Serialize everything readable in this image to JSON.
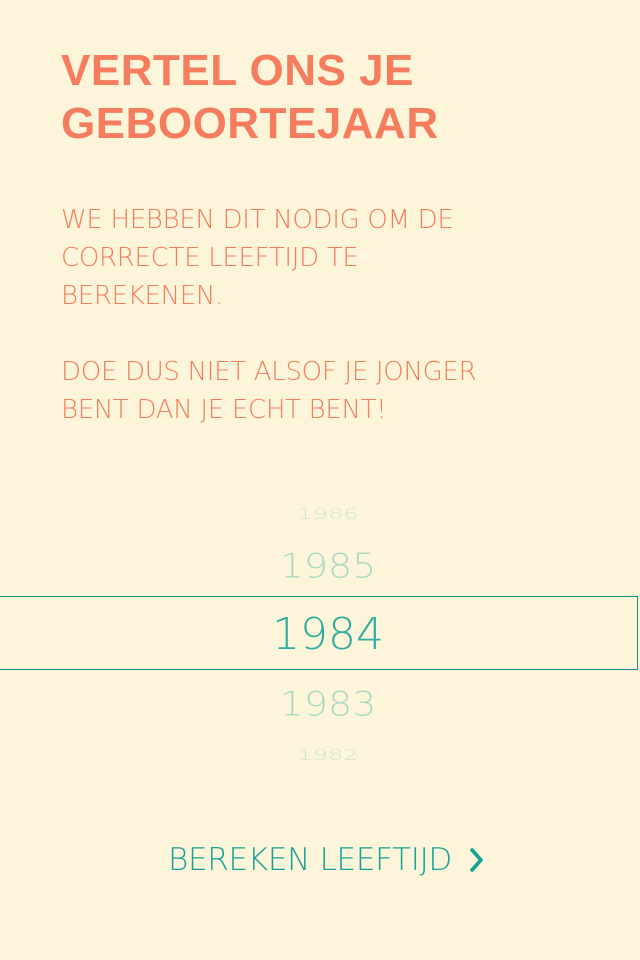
{
  "header": {
    "title_line_1": "VERTEL ONS JE",
    "title_line_2": "GEBOORTEJAAR"
  },
  "intro": {
    "paragraph_1_lines": [
      "WE HEBBEN DIT NODIG OM DE",
      "CORRECTE LEEFTIJD TE",
      "BEREKENEN."
    ],
    "paragraph_2_lines": [
      "DOE DUS NIET ALSOF JE JONGER",
      "BENT DAN JE ECHT BENT!"
    ]
  },
  "year_picker": {
    "visible_years": [
      "1986",
      "1985",
      "1984",
      "1983",
      "1982"
    ],
    "selected_year": "1984",
    "text_color": "#2fada0"
  },
  "action": {
    "label": "BEREKEN LEEFTIJD",
    "icon": "chevron-right-icon"
  },
  "colors": {
    "background": "#fcf5d9",
    "heading": "#f57d5e",
    "accent": "#17a197"
  }
}
